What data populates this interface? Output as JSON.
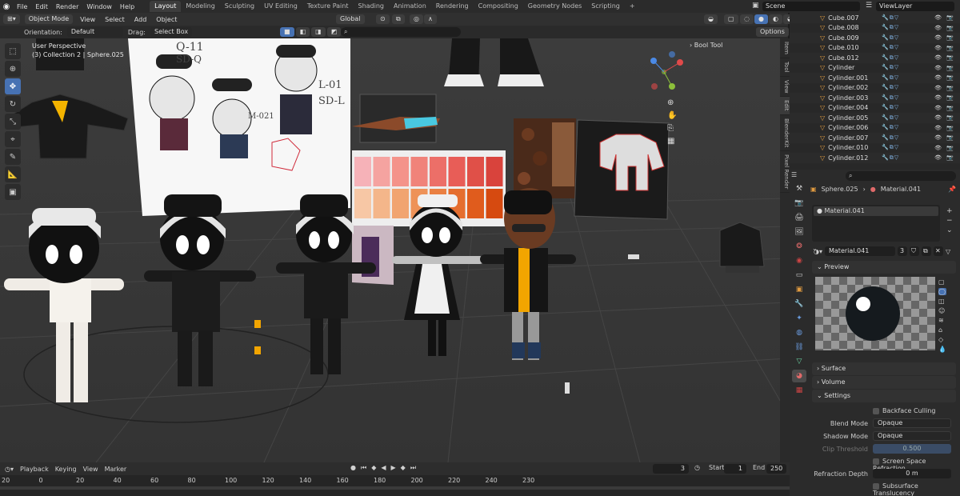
{
  "topbar": {
    "menus": [
      "File",
      "Edit",
      "Render",
      "Window",
      "Help"
    ],
    "workspaces": [
      "Layout",
      "Modeling",
      "Sculpting",
      "UV Editing",
      "Texture Paint",
      "Shading",
      "Animation",
      "Rendering",
      "Compositing",
      "Geometry Nodes",
      "Scripting"
    ],
    "active_workspace": "Layout",
    "add_tab": "+",
    "scene": "Scene",
    "view_layer": "ViewLayer"
  },
  "viewport_header": {
    "mode": "Object Mode",
    "menus": [
      "View",
      "Select",
      "Add",
      "Object"
    ],
    "transform": "Global",
    "orientation_label": "Orientation:",
    "orientation_value": "Default",
    "drag_label": "Drag:",
    "drag_value": "Select Box",
    "options": "Options"
  },
  "viewport": {
    "perspective": "User Perspective",
    "collection": "(3) Collection 2 | Sphere.025",
    "bool_tool": "Bool Tool",
    "sheet_text_1": "Q-11",
    "sheet_text_2": "SD-Q",
    "sheet_text_3": "L-01",
    "sheet_text_4": "SD-L",
    "sheet_text_5": "M-021"
  },
  "npanel_tabs": [
    "Item",
    "Tool",
    "View",
    "Edit",
    "BlenderKit",
    "Pixel Render"
  ],
  "outliner": {
    "rows": [
      "Cube.007",
      "Cube.008",
      "Cube.009",
      "Cube.010",
      "Cube.012",
      "Cylinder",
      "Cylinder.001",
      "Cylinder.002",
      "Cylinder.003",
      "Cylinder.004",
      "Cylinder.005",
      "Cylinder.006",
      "Cylinder.007",
      "Cylinder.010",
      "Cylinder.012"
    ]
  },
  "properties": {
    "object": "Sphere.025",
    "material": "Material.041",
    "slot": "Material.041",
    "material_field": "Material.041",
    "users": "3",
    "sections": {
      "preview": "Preview",
      "surface": "Surface",
      "volume": "Volume",
      "settings": "Settings"
    },
    "backface_culling": "Backface Culling",
    "blend_mode_label": "Blend Mode",
    "blend_mode": "Opaque",
    "shadow_mode_label": "Shadow Mode",
    "shadow_mode": "Opaque",
    "clip_label": "Clip Threshold",
    "clip_value": "0.500",
    "ssr": "Screen Space Refraction",
    "refraction_label": "Refraction Depth",
    "refraction_value": "0 m",
    "sss": "Subsurface Translucency"
  },
  "timeline": {
    "menus": [
      "Playback",
      "Keying",
      "View",
      "Marker"
    ],
    "current_frame": "3",
    "start_label": "Start",
    "start": "1",
    "end_label": "End",
    "end": "250",
    "ticks": [
      "20",
      "0",
      "20",
      "40",
      "60",
      "80",
      "100",
      "120",
      "140",
      "160",
      "180",
      "200",
      "220",
      "240",
      "230"
    ]
  },
  "palette": [
    "#f6b2b8",
    "#f5a3a0",
    "#f4938a",
    "#f0837a",
    "#ec6f68",
    "#e85d57",
    "#e05048",
    "#d9433c",
    "#f7c7a5",
    "#f4b68a",
    "#f1a470",
    "#ee9258",
    "#ea8042",
    "#e56e2f",
    "#e05c1d",
    "#d64a10"
  ]
}
